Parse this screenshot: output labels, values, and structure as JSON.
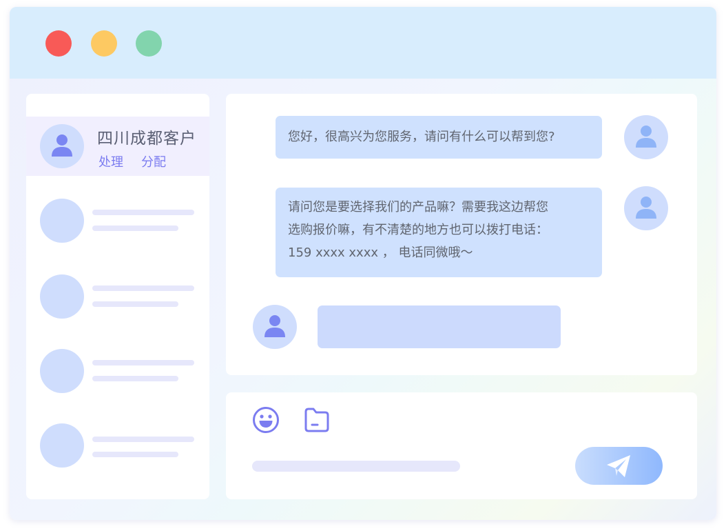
{
  "window": {
    "controls": {
      "close_color": "#f85a57",
      "minimize_color": "#fdc962",
      "maximize_color": "#82d4ad"
    }
  },
  "sidebar": {
    "active_contact": {
      "name": "四川成都客户",
      "actions": [
        "处理",
        "分配"
      ]
    },
    "placeholder_contacts": 4
  },
  "chat": {
    "messages": [
      {
        "from": "agent",
        "lines": [
          "您好，很高兴为您服务，请问有什么可以帮到您?"
        ]
      },
      {
        "from": "agent",
        "lines": [
          "请问您是要选择我们的产品嘛？需要我这边帮您",
          "选购报价嘛，有不清楚的地方也可以拨打电话：",
          "159 xxxx xxxx ， 电话同微哦～"
        ]
      },
      {
        "from": "customer",
        "lines": []
      }
    ]
  },
  "composer": {
    "icons": [
      "emoji-icon",
      "folder-icon"
    ],
    "send_icon": "paper-plane-icon",
    "accent": "#7b7cf0"
  }
}
